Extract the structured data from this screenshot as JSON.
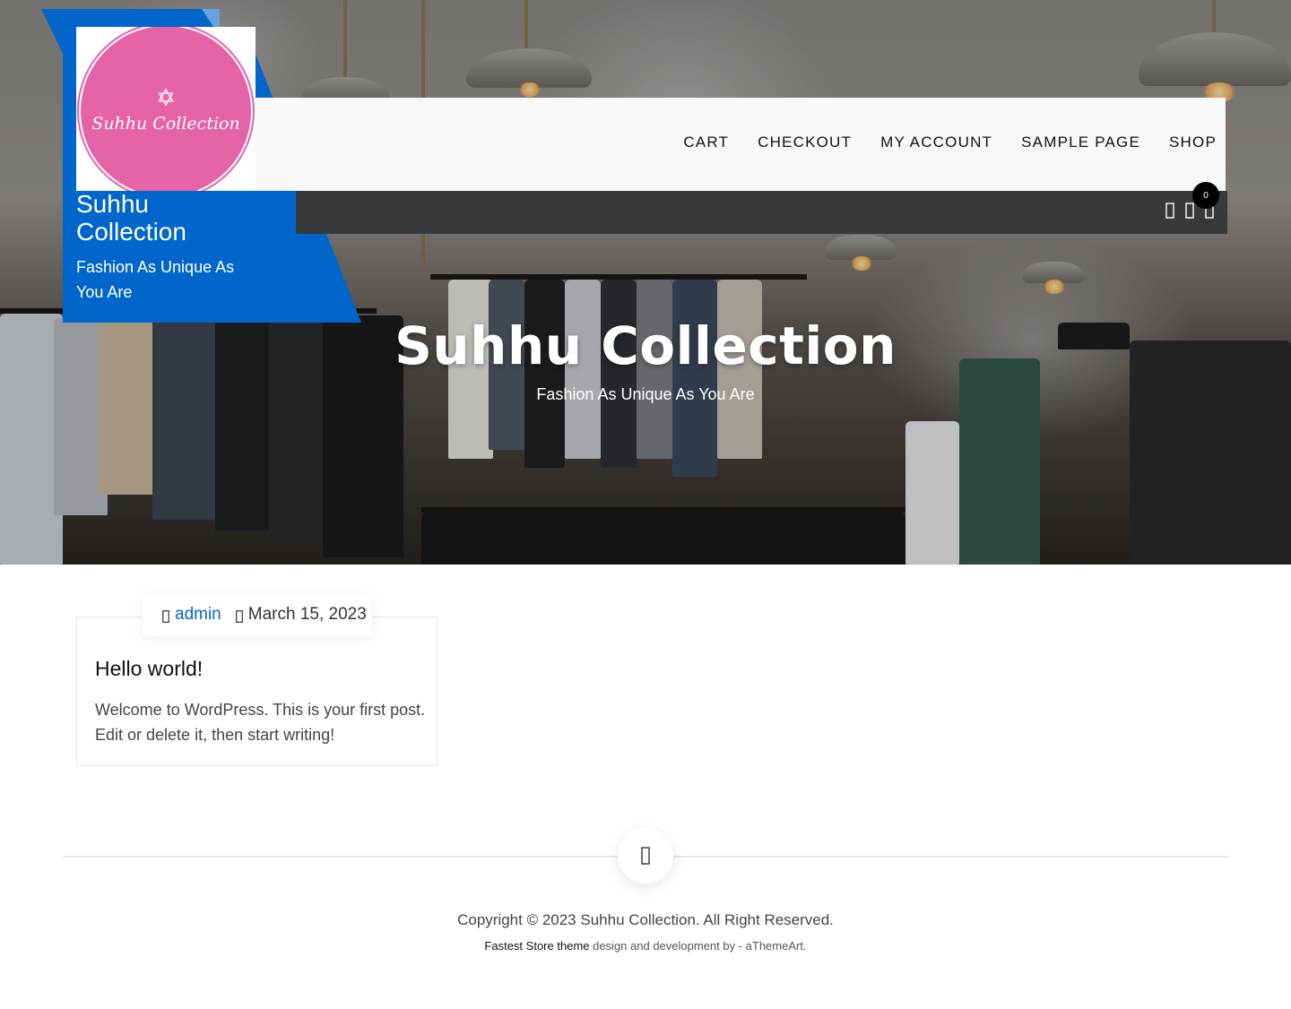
{
  "header": {
    "logo_text": "Suhhu Collection",
    "site_title": "Suhhu Collection",
    "tagline": "Fashion As Unique As You Are"
  },
  "nav": {
    "items": [
      {
        "label": "CART"
      },
      {
        "label": "CHECKOUT"
      },
      {
        "label": "MY ACCOUNT"
      },
      {
        "label": "SAMPLE PAGE"
      },
      {
        "label": "SHOP"
      }
    ],
    "cart_count": "0",
    "icons": [
      "search-icon",
      "user-icon",
      "cart-icon"
    ]
  },
  "hero": {
    "title": "Suhhu Collection",
    "subtitle": "Fashion As Unique As You Are"
  },
  "post": {
    "author": "admin",
    "date": "March 15, 2023",
    "title": "Hello world!",
    "excerpt": "Welcome to WordPress. This is your first post. Edit or delete it, then start writing!"
  },
  "footer": {
    "copyright": "Copyright © 2023 Suhhu Collection. All Right Reserved.",
    "credit_link": "Fastest Store theme",
    "credit_rest": " design and development by - aThemeArt."
  },
  "colors": {
    "brand_blue": "#0066cc",
    "logo_pink": "#e563a7",
    "subbar": "#363a3d"
  }
}
